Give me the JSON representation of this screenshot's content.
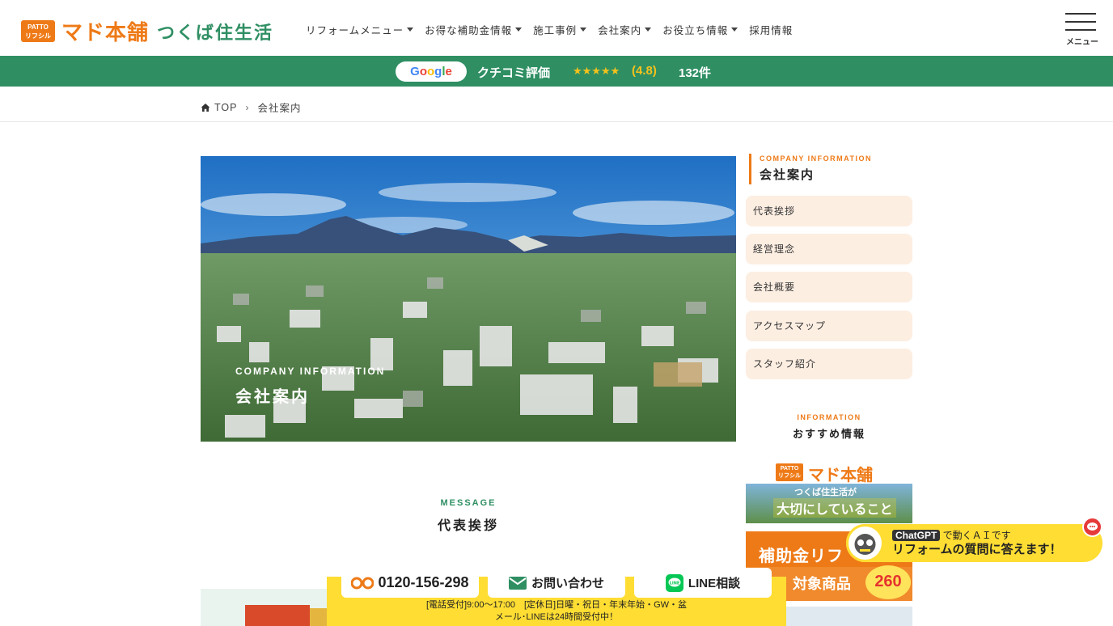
{
  "header": {
    "logo_badge_top": "PATTO",
    "logo_badge_bottom": "リフシル",
    "logo_main": "マド本舗",
    "logo_sub": "つくば住生活",
    "nav": [
      {
        "label": "リフォームメニュー",
        "dropdown": true
      },
      {
        "label": "お得な補助金情報",
        "dropdown": true
      },
      {
        "label": "施工事例",
        "dropdown": true
      },
      {
        "label": "会社案内",
        "dropdown": true
      },
      {
        "label": "お役立ち情報",
        "dropdown": true
      },
      {
        "label": "採用情報",
        "dropdown": false
      }
    ],
    "menu_label": "メニュー"
  },
  "review_bar": {
    "google": "Google",
    "label": "クチコミ評価",
    "stars": "★★★★★",
    "score": "(4.8)",
    "count": "132件"
  },
  "breadcrumb": {
    "home": "TOP",
    "current": "会社案内"
  },
  "hero": {
    "label_en": "COMPANY INFORMATION",
    "title": "会社案内"
  },
  "message_section": {
    "label_en": "MESSAGE",
    "title": "代表挨拶"
  },
  "sidebar": {
    "head_en": "COMPANY INFORMATION",
    "head_ja": "会社案内",
    "items": [
      "代表挨拶",
      "経営理念",
      "会社概要",
      "アクセスマップ",
      "スタッフ紹介"
    ],
    "info_en": "INFORMATION",
    "info_ja": "おすすめ情報",
    "banner1": {
      "badge_top": "PATTO",
      "badge_bottom": "リフシル",
      "main": "マド本舗",
      "sub": "つくば住生活が",
      "big": "大切にしていること"
    },
    "banner2": {
      "title": "補助金リフ",
      "sub": "対象商品",
      "circle": "260"
    }
  },
  "chat_widget": {
    "gpt": "ChatGPT",
    "line1_rest": " で動くＡＩです",
    "line2": "リフォームの質問に答えます！"
  },
  "cta": {
    "phone": "0120-156-298",
    "contact": "お問い合わせ",
    "line": "LINE相談",
    "note1": "[電話受付]9:00～17:00　[定休日]日曜・祝日・年末年始・GW・盆",
    "note2": "メール･LINEは24時間受付中！"
  },
  "colors": {
    "brand_orange": "#ee7a17",
    "brand_green": "#2f8f63",
    "cta_yellow": "#ffdd33",
    "side_item_bg": "#fdeee2"
  }
}
